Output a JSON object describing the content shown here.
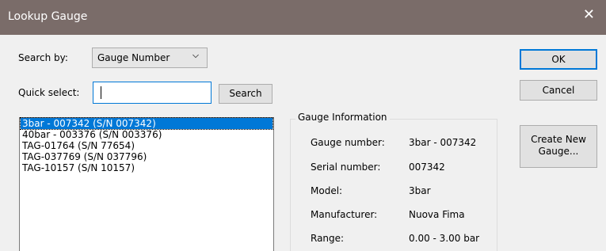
{
  "window": {
    "title": "Lookup Gauge",
    "close_icon": "close-icon"
  },
  "search": {
    "label": "Search by:",
    "selected": "Gauge Number",
    "dropdown_icon": "chevron-down-icon"
  },
  "quick_select": {
    "label": "Quick select:",
    "value": "",
    "search_button": "Search"
  },
  "gauge_list": [
    "3bar - 007342 (S/N 007342)",
    "40bar - 003376 (S/N 003376)",
    "TAG-01764 (S/N 77654)",
    "TAG-037769 (S/N 037796)",
    "TAG-10157 (S/N 10157)"
  ],
  "gauge_info": {
    "title": "Gauge Information",
    "fields": [
      {
        "label": "Gauge number:",
        "value": "3bar - 007342"
      },
      {
        "label": "Serial number:",
        "value": "007342"
      },
      {
        "label": "Model:",
        "value": "3bar"
      },
      {
        "label": "Manufacturer:",
        "value": "Nuova Fima"
      },
      {
        "label": "Range:",
        "value": "0.00 - 3.00 bar"
      }
    ]
  },
  "buttons": {
    "ok": "OK",
    "cancel": "Cancel",
    "create_line1": "Create New",
    "create_line2": "Gauge..."
  },
  "colors": {
    "titlebar": "#7a6c69",
    "selection": "#0078d7",
    "dialog_bg": "#f0f0f0"
  }
}
